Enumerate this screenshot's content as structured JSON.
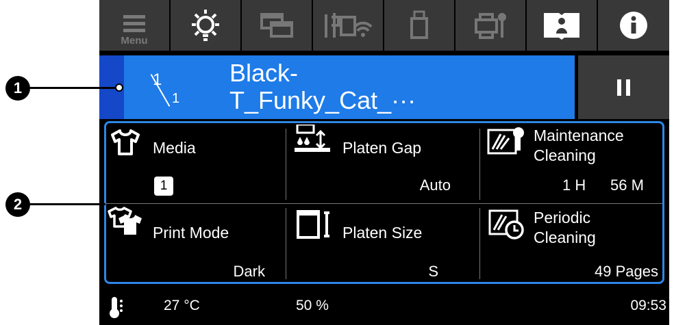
{
  "toolbar": {
    "menu_label": "Menu",
    "buttons": [
      "menu-icon",
      "light-icon",
      "layers-icon",
      "network-icon",
      "usb-icon",
      "printer-settings-icon",
      "manual-icon",
      "info-icon"
    ]
  },
  "job": {
    "current": "1",
    "total": "1",
    "name_line1": "Black-",
    "name_line2": "T_Funky_Cat_···"
  },
  "info": {
    "media": {
      "label": "Media",
      "value": "1"
    },
    "platen_gap": {
      "label": "Platen Gap",
      "value": "Auto"
    },
    "maintenance": {
      "label_line1": "Maintenance",
      "label_line2": "Cleaning",
      "hours": "1 H",
      "minutes": "56 M"
    },
    "print_mode": {
      "label": "Print Mode",
      "value": "Dark"
    },
    "platen_size": {
      "label": "Platen Size",
      "value": "S"
    },
    "periodic": {
      "label_line1": "Periodic",
      "label_line2": "Cleaning",
      "value": "49 Pages"
    }
  },
  "status": {
    "temperature": "27 °C",
    "humidity": "50 %",
    "time": "09:53"
  },
  "callouts": {
    "one": "1",
    "two": "2"
  },
  "colors": {
    "job_bg": "#1e7be8",
    "accent": "#1448c8",
    "border": "#2e86e8",
    "toolbar_bg": "#383838"
  }
}
